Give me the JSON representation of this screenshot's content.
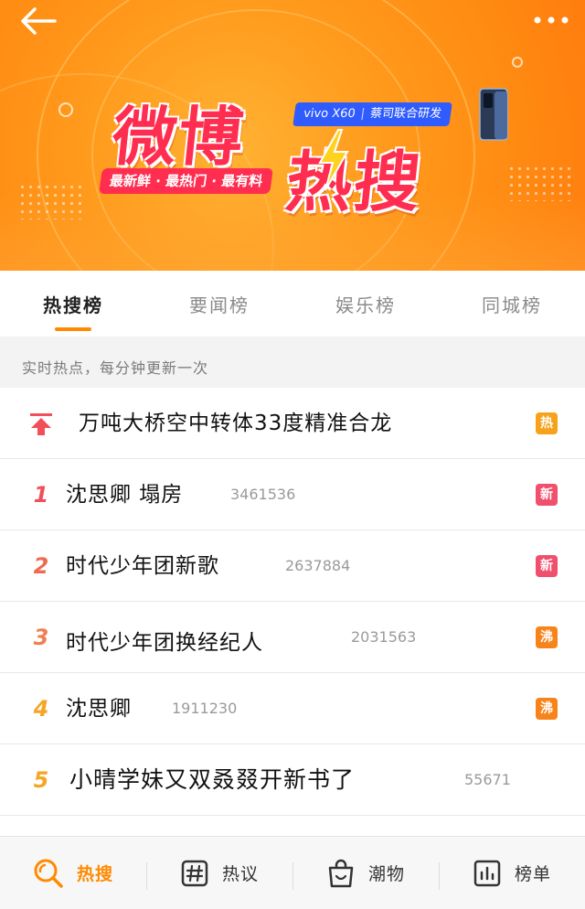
{
  "banner": {
    "title_line1": "微博",
    "title_line2": "热搜",
    "slogan": "最新鲜 · 最热门 · 最有料",
    "sponsor_brand": "vivo X60",
    "sponsor_text": "蔡司联合研发",
    "colors": {
      "background": "#ff9a1c",
      "title": "#ff2d4f",
      "sponsor": "#2f5bff"
    }
  },
  "header": {
    "back_icon": "arrow-left-icon",
    "more_icon": "more-dots-icon"
  },
  "tabs": [
    {
      "label": "热搜榜",
      "active": true
    },
    {
      "label": "要闻榜",
      "active": false
    },
    {
      "label": "娱乐榜",
      "active": false
    },
    {
      "label": "同城榜",
      "active": false
    }
  ],
  "notice": "实时热点，每分钟更新一次",
  "list": [
    {
      "rank": "",
      "rank_icon": "pin-top-icon",
      "title": "万吨大桥空中转体33度精准合龙",
      "count": "",
      "badge": "热",
      "badge_color": "#f7a21b"
    },
    {
      "rank": "1",
      "title": "沈思卿  塌房",
      "count": "3461536",
      "badge": "新",
      "badge_color": "#f0506e"
    },
    {
      "rank": "2",
      "title": "时代少年团新歌",
      "count": "2637884",
      "badge": "新",
      "badge_color": "#f0506e"
    },
    {
      "rank": "3",
      "title": "时代少年团换经纪人",
      "count": "2031563",
      "badge": "沸",
      "badge_color": "#f7831b"
    },
    {
      "rank": "4",
      "title": "沈思卿",
      "count": "1911230",
      "badge": "沸",
      "badge_color": "#f7831b"
    },
    {
      "rank": "5",
      "title": "小晴学妹又双叒叕开新书了",
      "count": "55671",
      "badge": "",
      "badge_color": ""
    }
  ],
  "rank_colors": {
    "1": "#f0505a",
    "2": "#f06a50",
    "3": "#f07e50",
    "4": "#f5a623",
    "5": "#f5a623"
  },
  "bottom_nav": [
    {
      "label": "热搜",
      "icon": "search-icon",
      "active": true
    },
    {
      "label": "热议",
      "icon": "hashtag-icon",
      "active": false
    },
    {
      "label": "潮物",
      "icon": "shopping-bag-icon",
      "active": false
    },
    {
      "label": "榜单",
      "icon": "bar-chart-icon",
      "active": false
    }
  ]
}
